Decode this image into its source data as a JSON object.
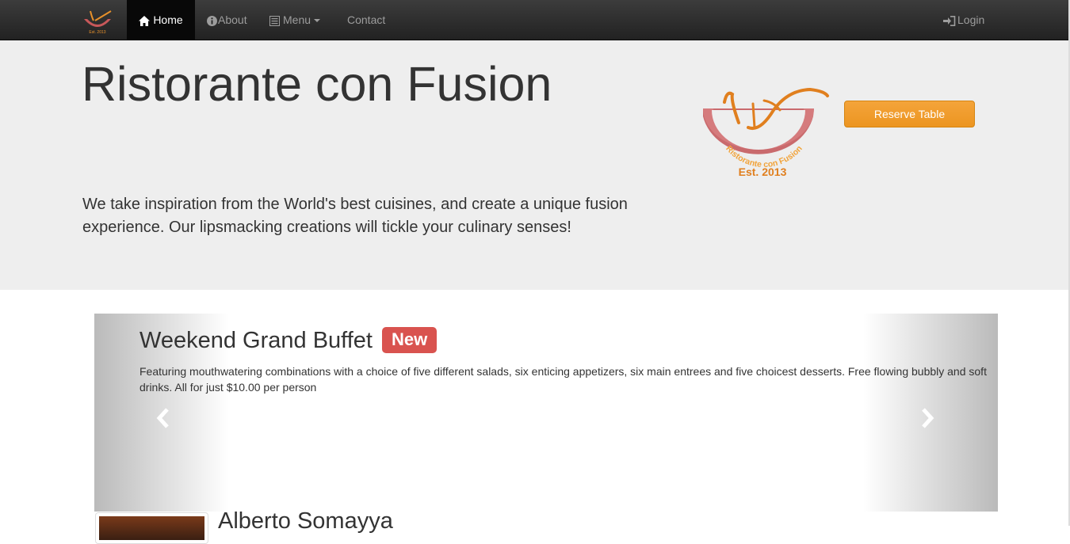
{
  "nav": {
    "items": [
      {
        "label": "Home",
        "icon": "home-icon",
        "active": true
      },
      {
        "label": "About",
        "icon": "info-circle-icon"
      },
      {
        "label": "Menu",
        "icon": "list-icon",
        "dropdown": true
      },
      {
        "label": "Contact"
      }
    ],
    "login_label": "Login",
    "login_icon": "sign-in-icon",
    "logo_text": "Est. 2013"
  },
  "jumbotron": {
    "title": "Ristorante con Fusion",
    "text": "We take inspiration from the World's best cuisines, and create a unique fusion experience. Our lipsmacking creations will tickle your culinary senses!",
    "logo_arc_text": "Ristorante con Fusion",
    "logo_est": "Est. 2013",
    "reserve_label": "Reserve Table"
  },
  "carousel": {
    "title": "Weekend Grand Buffet",
    "badge": "New",
    "description": "Featuring mouthwatering combinations with a choice of five different salads, six enticing appetizers, six main entrees and five choicest desserts. Free flowing bubbly and soft drinks. All for just $10.00 per person",
    "prev_icon": "chevron-left-icon",
    "next_icon": "chevron-right-icon"
  },
  "next_item": {
    "name": "Alberto Somayya"
  },
  "colors": {
    "navbar": "#222222",
    "jumbotron": "#eeeeee",
    "accent_orange": "#f0a030",
    "badge_red": "#d9534f"
  }
}
